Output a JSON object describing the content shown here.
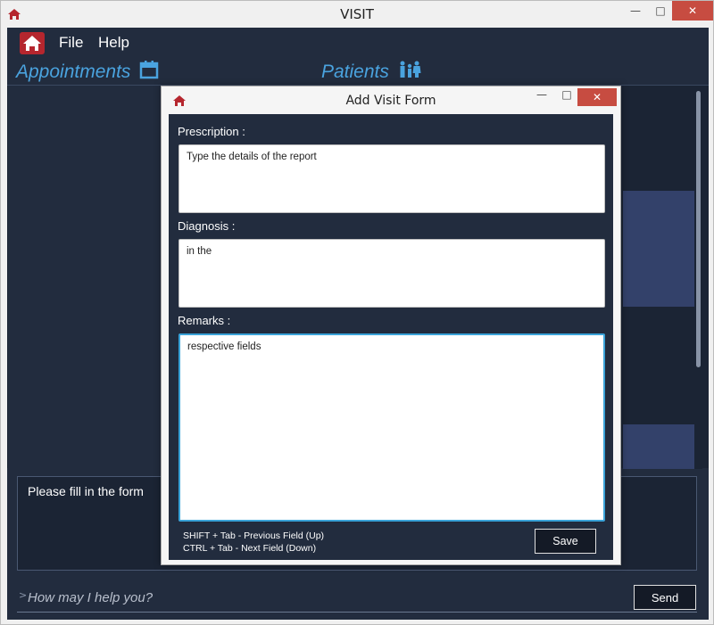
{
  "window": {
    "title": "VISIT",
    "icons": {
      "app": "home-icon"
    }
  },
  "menu": {
    "file": "File",
    "help": "Help"
  },
  "tabs": {
    "appointments": "Appointments",
    "patients": "Patients"
  },
  "message": {
    "text": "Please fill in the form"
  },
  "command": {
    "prompt_symbol": ">",
    "placeholder": "How may I help you?",
    "send_label": "Send"
  },
  "dialog": {
    "title": "Add Visit Form",
    "prescription_label": "Prescription :",
    "prescription_value": "Type the details of the report",
    "diagnosis_label": "Diagnosis :",
    "diagnosis_value": "in the",
    "remarks_label": "Remarks :",
    "remarks_value": "respective fields",
    "hint_prev": "SHIFT + Tab  -  Previous Field (Up)",
    "hint_next": "CTRL + Tab  -  Next Field (Down)",
    "save_label": "Save"
  },
  "colors": {
    "accent_blue": "#4aa3df",
    "panel_dark": "#222c3e",
    "home_red": "#b5262e",
    "close_red": "#c74c41"
  }
}
